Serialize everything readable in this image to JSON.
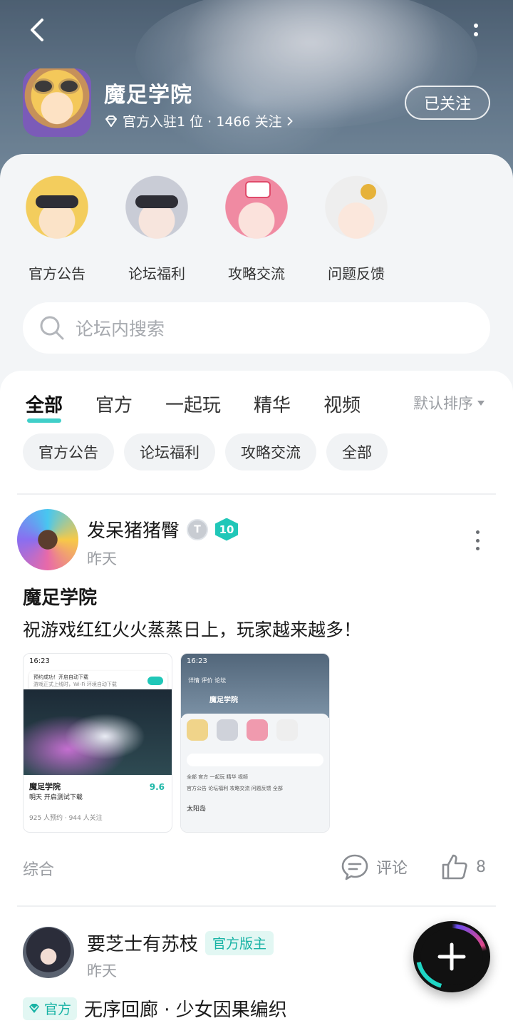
{
  "header": {
    "game_title": "魔足学院",
    "game_sub": "官方入驻1 位 · 1466 关注",
    "follow_label": "已关注"
  },
  "categories": [
    {
      "label": "官方公告"
    },
    {
      "label": "论坛福利"
    },
    {
      "label": "攻略交流"
    },
    {
      "label": "问题反馈"
    }
  ],
  "search": {
    "placeholder": "论坛内搜索"
  },
  "tabs": [
    {
      "label": "全部",
      "active": true
    },
    {
      "label": "官方"
    },
    {
      "label": "一起玩"
    },
    {
      "label": "精华"
    },
    {
      "label": "视频"
    }
  ],
  "sort_label": "默认排序",
  "chips": [
    "官方公告",
    "论坛福利",
    "攻略交流",
    "全部"
  ],
  "posts": [
    {
      "author": "发呆猪猪臀",
      "badge_level": "10",
      "time": "昨天",
      "title": "魔足学院",
      "body": "祝游戏红红火火蒸蒸日上，玩家越来越多！",
      "category": "综合",
      "comment_label": "评论",
      "likes": "8",
      "thumb1": {
        "time": "16:23",
        "notice_title": "预约成功！开启自动下载",
        "notice_sub": "游戏正式上线时，Wi-Fi 环境自动下载",
        "game": "魔足学院",
        "game_sub": "明天 开启测试下载",
        "score": "9.6",
        "stats": "925 人预约 · 944 人关注"
      },
      "thumb2": {
        "time": "16:23",
        "nav": "详情  评价  论坛",
        "game": "魔足学院",
        "tabs": "全部  官方  一起玩  精华  视频",
        "chips": "官方公告  论坛福利  攻略交流  问题反馈  全部",
        "user": "太阳岛"
      }
    },
    {
      "author": "要芝士有苏枝",
      "role_badge": "官方版主",
      "time": "昨天",
      "tag": "官方",
      "title": "无序回廊 · 少女因果编织"
    }
  ],
  "colors": {
    "accent": "#1fc7c0",
    "official_bg": "#e2f7f3",
    "official_text": "#18b3a5"
  }
}
